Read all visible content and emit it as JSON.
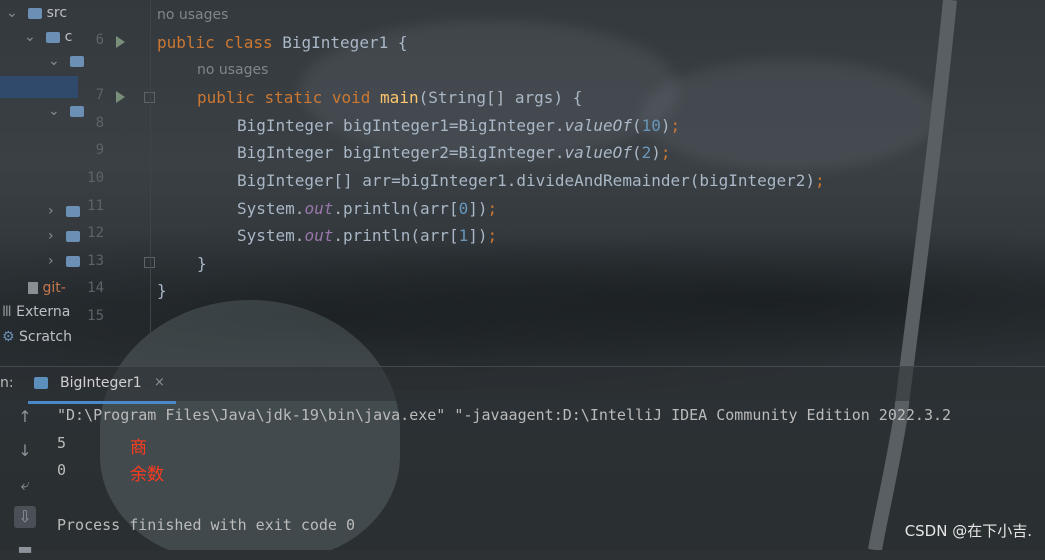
{
  "project_tree": {
    "items": [
      {
        "label": "src"
      },
      {
        "label": "c"
      },
      {
        "label": ""
      },
      {
        "label": ""
      },
      {
        "label": ""
      },
      {
        "label": "git-"
      },
      {
        "label": "Externa"
      },
      {
        "label": "Scratch"
      }
    ]
  },
  "editor": {
    "usage_hint_class": "no usages",
    "usage_hint_method": "no usages",
    "line_numbers": [
      "6",
      "7",
      "8",
      "9",
      "10",
      "11",
      "12",
      "13",
      "14",
      "15"
    ],
    "code": {
      "l6": {
        "kw1": "public",
        "kw2": "class",
        "name": "BigInteger1",
        "rest": " {"
      },
      "l7": {
        "kw1": "public",
        "kw2": "static",
        "kw3": "void",
        "fn": "main",
        "rest": "(String[] args) {"
      },
      "l8": {
        "a": "BigInteger bigInteger1=BigInteger.",
        "m": "valueOf",
        "p1": "(",
        "n": "10",
        "p2": ")",
        "semi": ";"
      },
      "l9": {
        "a": "BigInteger bigInteger2=BigInteger.",
        "m": "valueOf",
        "p1": "(",
        "n": "2",
        "p2": ")",
        "semi": ";"
      },
      "l10": {
        "a": "BigInteger[] arr=bigInteger1.divideAndRemainder(bigInteger2)",
        "semi": ";"
      },
      "l11": {
        "a": "System.",
        "f": "out",
        "b": ".println(arr[",
        "n": "0",
        "c": "])",
        "semi": ";"
      },
      "l12": {
        "a": "System.",
        "f": "out",
        "b": ".println(arr[",
        "n": "1",
        "c": "])",
        "semi": ";"
      },
      "l13": {
        "a": "}"
      },
      "l14": {
        "a": "}"
      }
    }
  },
  "run_window": {
    "label": "n:",
    "tab_label": "BigInteger1",
    "tab_close": "×",
    "console": [
      "\"D:\\Program Files\\Java\\jdk-19\\bin\\java.exe\" \"-javaagent:D:\\IntelliJ IDEA Community Edition 2022.3.2",
      "5",
      "0",
      "Process finished with exit code 0"
    ],
    "annotations": {
      "quotient": "商",
      "remainder": "余数"
    }
  },
  "watermark": "CSDN @在下小吉.",
  "colors": {
    "keyword": "#cc7832",
    "function": "#ffc66d",
    "number": "#6897bb",
    "field": "#9876aa",
    "annotation": "#ff3b1e"
  }
}
